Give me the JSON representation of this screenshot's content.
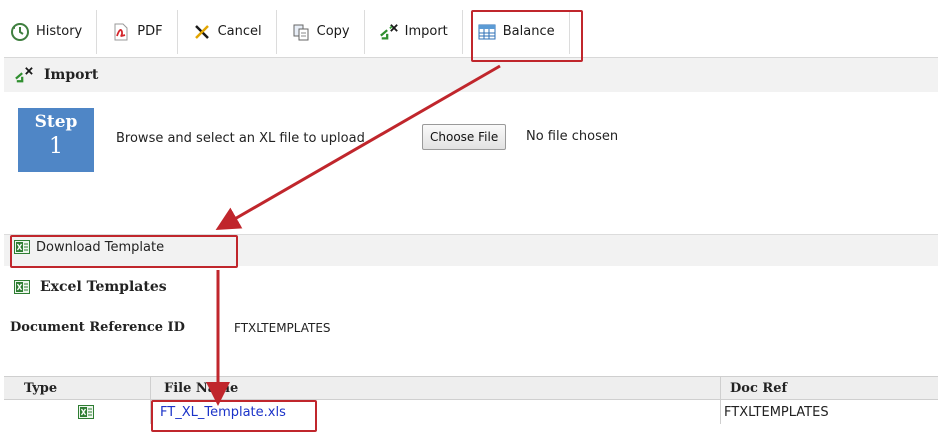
{
  "toolbar": {
    "items": [
      {
        "label": "History",
        "icon": "history-icon"
      },
      {
        "label": "PDF",
        "icon": "pdf-icon"
      },
      {
        "label": "Cancel",
        "icon": "cancel-icon"
      },
      {
        "label": "Copy",
        "icon": "copy-icon"
      },
      {
        "label": "Import",
        "icon": "import-icon"
      },
      {
        "label": "Balance",
        "icon": "balance-icon"
      }
    ]
  },
  "import_section": {
    "title": "Import"
  },
  "step": {
    "word": "Step",
    "number": "1",
    "instruction": "Browse and select an XL file to upload",
    "choose_file_label": "Choose File",
    "file_status": "No file chosen"
  },
  "download_template": {
    "label": "Download Template"
  },
  "excel_templates": {
    "title": "Excel Templates"
  },
  "doc_ref": {
    "label": "Document Reference ID",
    "value": "FTXLTEMPLATES"
  },
  "table": {
    "columns": [
      "Type",
      "File Name",
      "Doc Ref"
    ],
    "rows": [
      {
        "type_icon": "excel-file-icon",
        "file_name": "FT_XL_Template.xls",
        "doc_ref": "FTXLTEMPLATES"
      }
    ]
  },
  "colors": {
    "highlight": "#c0262c",
    "link": "#1b33c9",
    "step_box": "#4f86c6"
  }
}
